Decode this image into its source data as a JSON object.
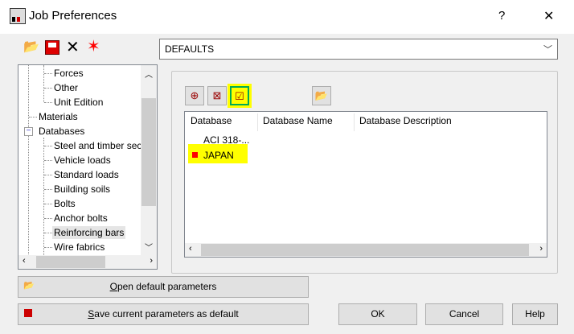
{
  "window": {
    "title": "Job Preferences",
    "help": "?",
    "close": "✕"
  },
  "toolbar": {
    "open_icon": "folder-open-icon",
    "save_icon": "save-icon",
    "delete_icon": "delete-icon",
    "reset_icon": "reset-icon"
  },
  "combo": {
    "value": "DEFAULTS"
  },
  "tree": {
    "items": [
      {
        "label": "Forces",
        "level": 2
      },
      {
        "label": "Other",
        "level": 2
      },
      {
        "label": "Unit Edition",
        "level": 2
      },
      {
        "label": "Materials",
        "level": 1
      },
      {
        "label": "Databases",
        "level": 1,
        "expanded": true
      },
      {
        "label": "Steel and timber sections",
        "level": 2
      },
      {
        "label": "Vehicle loads",
        "level": 2
      },
      {
        "label": "Standard loads",
        "level": 2
      },
      {
        "label": "Building soils",
        "level": 2
      },
      {
        "label": "Bolts",
        "level": 2
      },
      {
        "label": "Anchor bolts",
        "level": 2
      },
      {
        "label": "Reinforcing bars",
        "level": 2,
        "selected": true
      },
      {
        "label": "Wire fabrics",
        "level": 2
      }
    ]
  },
  "list": {
    "columns": [
      "Database",
      "Database Name",
      "Database Description"
    ],
    "rows": [
      {
        "database": "ACI 318-...",
        "active": false
      },
      {
        "database": "JAPAN",
        "active": true
      }
    ]
  },
  "buttons": {
    "open_default_first": "O",
    "open_default_rest": "pen default parameters",
    "save_default_first": "S",
    "save_default_rest": "ave current parameters as default",
    "ok": "OK",
    "cancel": "Cancel",
    "help": "Help"
  },
  "colors": {
    "highlight": "#ffff00",
    "active_marker": "#ff0000"
  }
}
